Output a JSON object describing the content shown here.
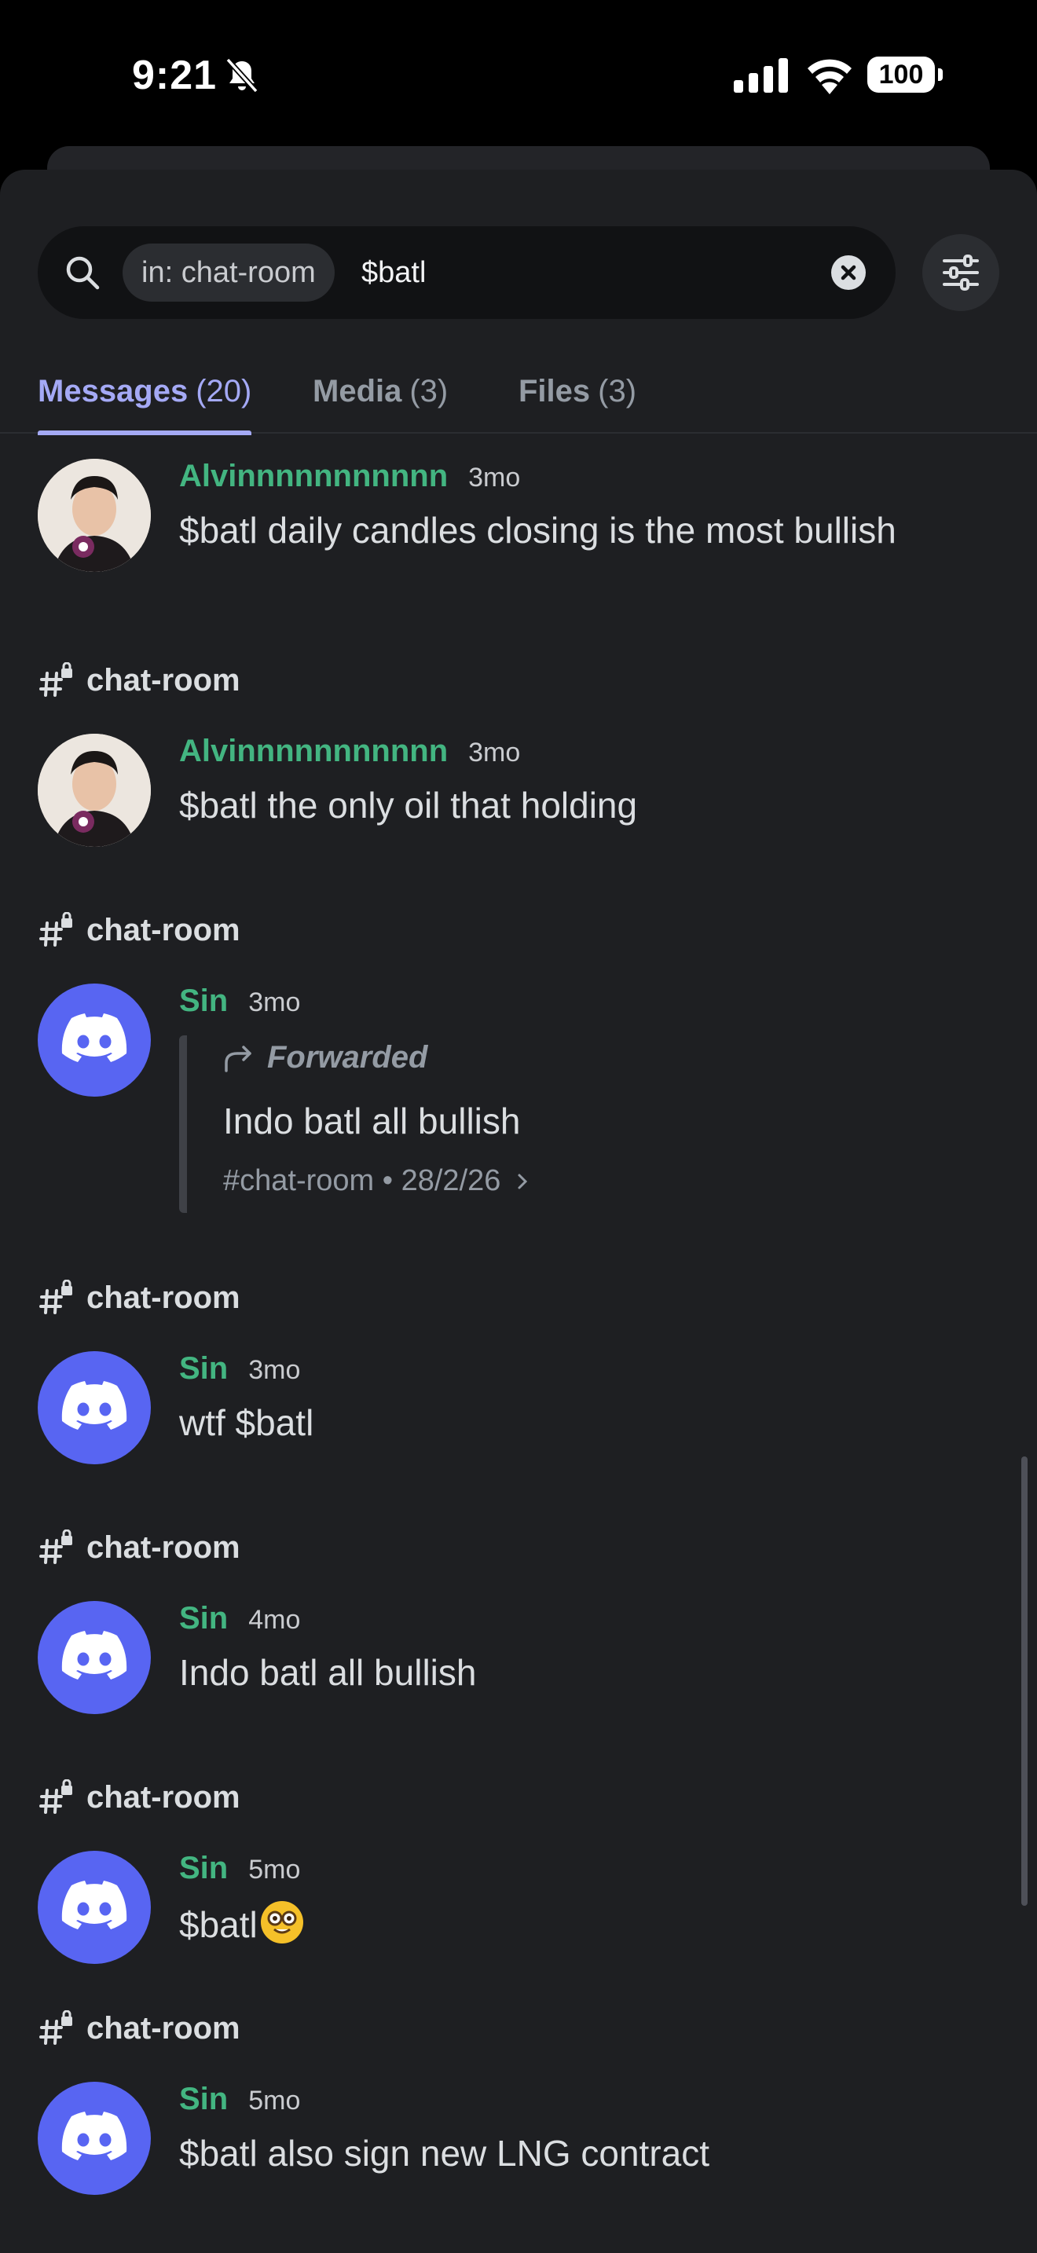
{
  "status_bar": {
    "time": "9:21",
    "battery": "100"
  },
  "search": {
    "filter_chip": "in: chat-room",
    "query": "$batl"
  },
  "tabs": [
    {
      "label": "Messages",
      "count": "(20)",
      "active": true
    },
    {
      "label": "Media",
      "count": "(3)",
      "active": false
    },
    {
      "label": "Files",
      "count": "(3)",
      "active": false
    }
  ],
  "results": [
    {
      "channel": "",
      "author": "Alvinnnnnnnnnnn",
      "time": "3mo",
      "text": "$batl daily candles closing is the most bullish",
      "avatar": "photo"
    },
    {
      "channel": "chat-room",
      "author": "Alvinnnnnnnnnnn",
      "time": "3mo",
      "text": "$batl the only oil that holding",
      "avatar": "photo"
    },
    {
      "channel": "chat-room",
      "author": "Sin",
      "time": "3mo",
      "avatar": "discord",
      "forwarded": {
        "label": "Forwarded",
        "text": "Indo batl all bullish",
        "source": "#chat-room • 28/2/26"
      }
    },
    {
      "channel": "chat-room",
      "author": "Sin",
      "time": "3mo",
      "text": "wtf $batl",
      "avatar": "discord"
    },
    {
      "channel": "chat-room",
      "author": "Sin",
      "time": "4mo",
      "text": "Indo batl all bullish",
      "avatar": "discord"
    },
    {
      "channel": "chat-room",
      "author": "Sin",
      "time": "5mo",
      "text": "$batl",
      "emoji": "nerd-face-emoji",
      "avatar": "discord"
    },
    {
      "channel": "chat-room",
      "author": "Sin",
      "time": "5mo",
      "text": "$batl also sign new LNG contract",
      "avatar": "discord"
    }
  ],
  "colors": {
    "background": "#1e1f22",
    "accent": "#a4a9f5",
    "author": "#43b581",
    "discord_blurple": "#5865f2"
  }
}
